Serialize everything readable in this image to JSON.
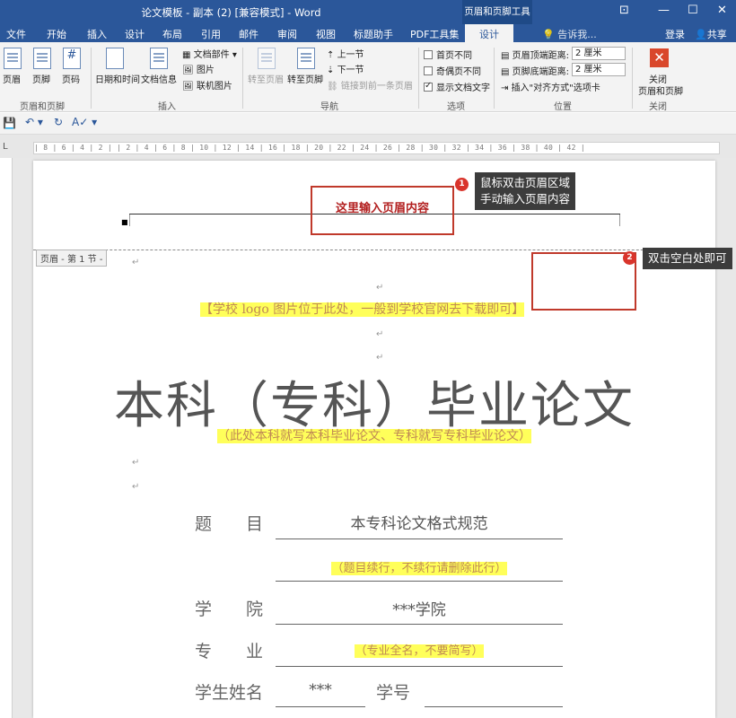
{
  "window": {
    "title": "论文模板 - 副本 (2) [兼容模式] - Word",
    "contextual_tools": "页眉和页脚工具",
    "controls": [
      "⊡",
      "—",
      "☐",
      "✕"
    ]
  },
  "tabs": [
    "文件",
    "开始",
    "插入",
    "设计",
    "布局",
    "引用",
    "邮件",
    "审阅",
    "视图",
    "标题助手",
    "PDF工具集",
    "设计"
  ],
  "tell_me": "告诉我...",
  "sign_in": "登录",
  "share": "共享",
  "ribbon": {
    "g1": {
      "buttons": [
        "页眉",
        "页脚",
        "页码"
      ],
      "label": "页眉和页脚"
    },
    "g2": {
      "buttons": [
        "日期和时间",
        "文档信息"
      ],
      "small": [
        "文档部件",
        "图片",
        "联机图片"
      ],
      "label": "插入"
    },
    "g3": {
      "big": [
        "转至页眉",
        "转至页脚"
      ],
      "small": [
        "上一节",
        "下一节",
        "链接到前一条页眉"
      ],
      "label": "导航"
    },
    "g4": {
      "options": [
        "首页不同",
        "奇偶页不同",
        "显示文档文字"
      ],
      "label": "选项"
    },
    "g5": {
      "fields": [
        "页眉顶端距离:",
        "页脚底端距离:"
      ],
      "values": [
        "2 厘米",
        "2 厘米"
      ],
      "insert": "插入\"对齐方式\"选项卡",
      "label": "位置"
    },
    "g6": {
      "button_line1": "关闭",
      "button_line2": "页眉和页脚",
      "label": "关闭"
    }
  },
  "ruler_text": "| 8 | 6 | 4 | 2 |   | 2 | 4 | 6 | 8 | 10 | 12 | 14 | 16 | 18 | 20 | 22 | 24 | 26 | 28 | 30 | 32 | 34 | 36 | 38 | 40 | 42 |",
  "page": {
    "header_placeholder": "这里输入页眉内容",
    "header_tag": "页眉 - 第 1 节 -",
    "logo_note": "【学校 logo 图片位于此处，一般到学校官网去下载即可】",
    "main_title": "本科（专科）毕业论文",
    "sub_note": "（此处本科就写本科毕业论文、专科就写专科毕业论文）",
    "fields": {
      "topic_label": "题　　目",
      "topic_value": "本专科论文格式规范",
      "topic_note": "（题目续行，不续行请删除此行）",
      "college_label": "学　　院",
      "college_value": "***学院",
      "major_label": "专　　业",
      "major_note": "（专业全名，不要简写）",
      "name_label": "学生姓名",
      "name_value": "***",
      "id_label": "学号"
    }
  },
  "callouts": {
    "one": {
      "num": "1",
      "text1": "鼠标双击页眉区域",
      "text2": "手动输入页眉内容"
    },
    "two": {
      "num": "2",
      "text": "双击空白处即可"
    }
  }
}
